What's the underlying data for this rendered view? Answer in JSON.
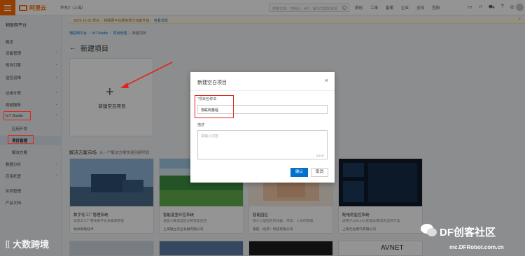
{
  "topbar": {
    "logo_text": "阿里云",
    "region": "华东2（上海）",
    "search_placeholder": "搜索文档、控制台、API、解决方案和资源",
    "links": [
      "费用",
      "工单",
      "备案",
      "企业",
      "支持",
      "官网"
    ],
    "icons": [
      "terminal-icon",
      "bell-icon",
      "cart-icon",
      "help-icon",
      "globe-icon"
    ],
    "accent": "#ff6a00"
  },
  "sidebar": {
    "title": "物联网平台",
    "items": [
      {
        "label": "概览"
      },
      {
        "label": "设备管理",
        "chevron": "⌄"
      },
      {
        "label": "规则引擎",
        "chevron": "⌄"
      },
      {
        "label": "监控运维",
        "chevron": "⌄"
      },
      {
        "label": "边缘计算",
        "chevron": "⌄"
      },
      {
        "label": "视频服务",
        "chevron": "⌄"
      },
      {
        "label": "IoT Studio",
        "chevron": "⌃"
      },
      {
        "label": "数据分析",
        "chevron": "⌄"
      },
      {
        "label": "应用托管",
        "chevron": "⌄"
      },
      {
        "label": "实例管理"
      },
      {
        "label": "产品文档"
      }
    ],
    "subitems": [
      "应用开发",
      "项目管理",
      "解决方案"
    ]
  },
  "notice": {
    "text": "2019-12-31 零点 ，物联网平台服务部分功能升级，",
    "link": "查看详情",
    "close": "×"
  },
  "breadcrumb": [
    "物联网平台",
    "IoT Studio",
    "项目管理",
    "新建项目"
  ],
  "page": {
    "back": "←",
    "title": "新建项目",
    "new_card_plus": "+",
    "new_card_label": "新建空白项目",
    "section_title": "解决方案市场",
    "section_sub": "从一个解决方案快速创建项目"
  },
  "solutions": [
    {
      "name": "数字化工厂管理系统",
      "desc": "实现对工厂整体数字化采集和整理",
      "company": "杭州新联技术"
    },
    {
      "name": "智能温室环控系统",
      "desc": "温室大棚温湿度光照智能监控",
      "company": "上海德立农业发展有限公司"
    },
    {
      "name": "智能园区",
      "desc": "简介小型园区的设备、停车、人员的管理",
      "company": "意航（北京）科技有限公司"
    },
    {
      "name": "配电房监控系统",
      "desc": "适用于10/0.4kV变电站/配电房监控方案",
      "company": "上海元拉电气有限公司"
    }
  ],
  "solutions_row2": [
    "",
    "",
    "",
    "AVNET"
  ],
  "modal": {
    "title": "新建空白项目",
    "close": "×",
    "name_label": "项目名称",
    "name_required": "*",
    "name_value": "物联网量程",
    "desc_label": "描述",
    "desc_placeholder": "请输入内容",
    "desc_counter": "0/100",
    "ok": "确认",
    "cancel": "取消"
  },
  "watermark": {
    "left_mark": "[[",
    "left_text": "大数跨境",
    "right_name": "DF创客社区",
    "right_url": "mc.DFRobot.com.cn"
  },
  "colors": {
    "highlight": "#e2231a",
    "primary": "#0070cc"
  }
}
